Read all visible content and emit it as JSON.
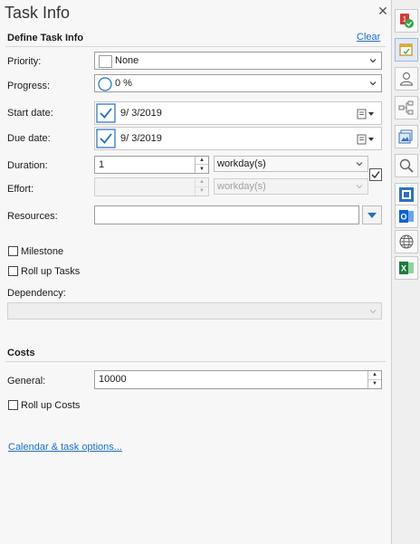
{
  "panel": {
    "title": "Task Info",
    "define_section": "Define Task Info",
    "clear_link": "Clear",
    "priority": {
      "label": "Priority:",
      "value": "None"
    },
    "progress": {
      "label": "Progress:",
      "value": "0 %"
    },
    "start_date": {
      "label": "Start date:",
      "value": "9/  3/2019",
      "checked": true
    },
    "due_date": {
      "label": "Due date:",
      "value": "9/  3/2019",
      "checked": true
    },
    "duration": {
      "label": "Duration:",
      "value": "1",
      "unit": "workday(s)"
    },
    "effort": {
      "label": "Effort:",
      "value": "",
      "unit": "workday(s)"
    },
    "resources": {
      "label": "Resources:",
      "value": ""
    },
    "milestone": {
      "label": "Milestone",
      "checked": false
    },
    "rollup_tasks": {
      "label": "Roll up Tasks",
      "checked": false
    },
    "dependency": {
      "label": "Dependency:",
      "value": ""
    },
    "costs_section": "Costs",
    "general": {
      "label": "General:",
      "value": "10000"
    },
    "rollup_costs": {
      "label": "Roll up Costs",
      "checked": false
    },
    "calendar_link": "Calendar & task options..."
  },
  "sidebar": {
    "icons": [
      "task-priority-icon",
      "task-info-icon",
      "resources-icon",
      "topic-link-icon",
      "image-icon",
      "search-icon",
      "map-overview-icon",
      "outlook-icon",
      "web-icon",
      "excel-icon"
    ]
  },
  "colors": {
    "accent": "#1f6fc1",
    "check": "#1f6fc1",
    "panel_bg": "#f7f7f7"
  }
}
